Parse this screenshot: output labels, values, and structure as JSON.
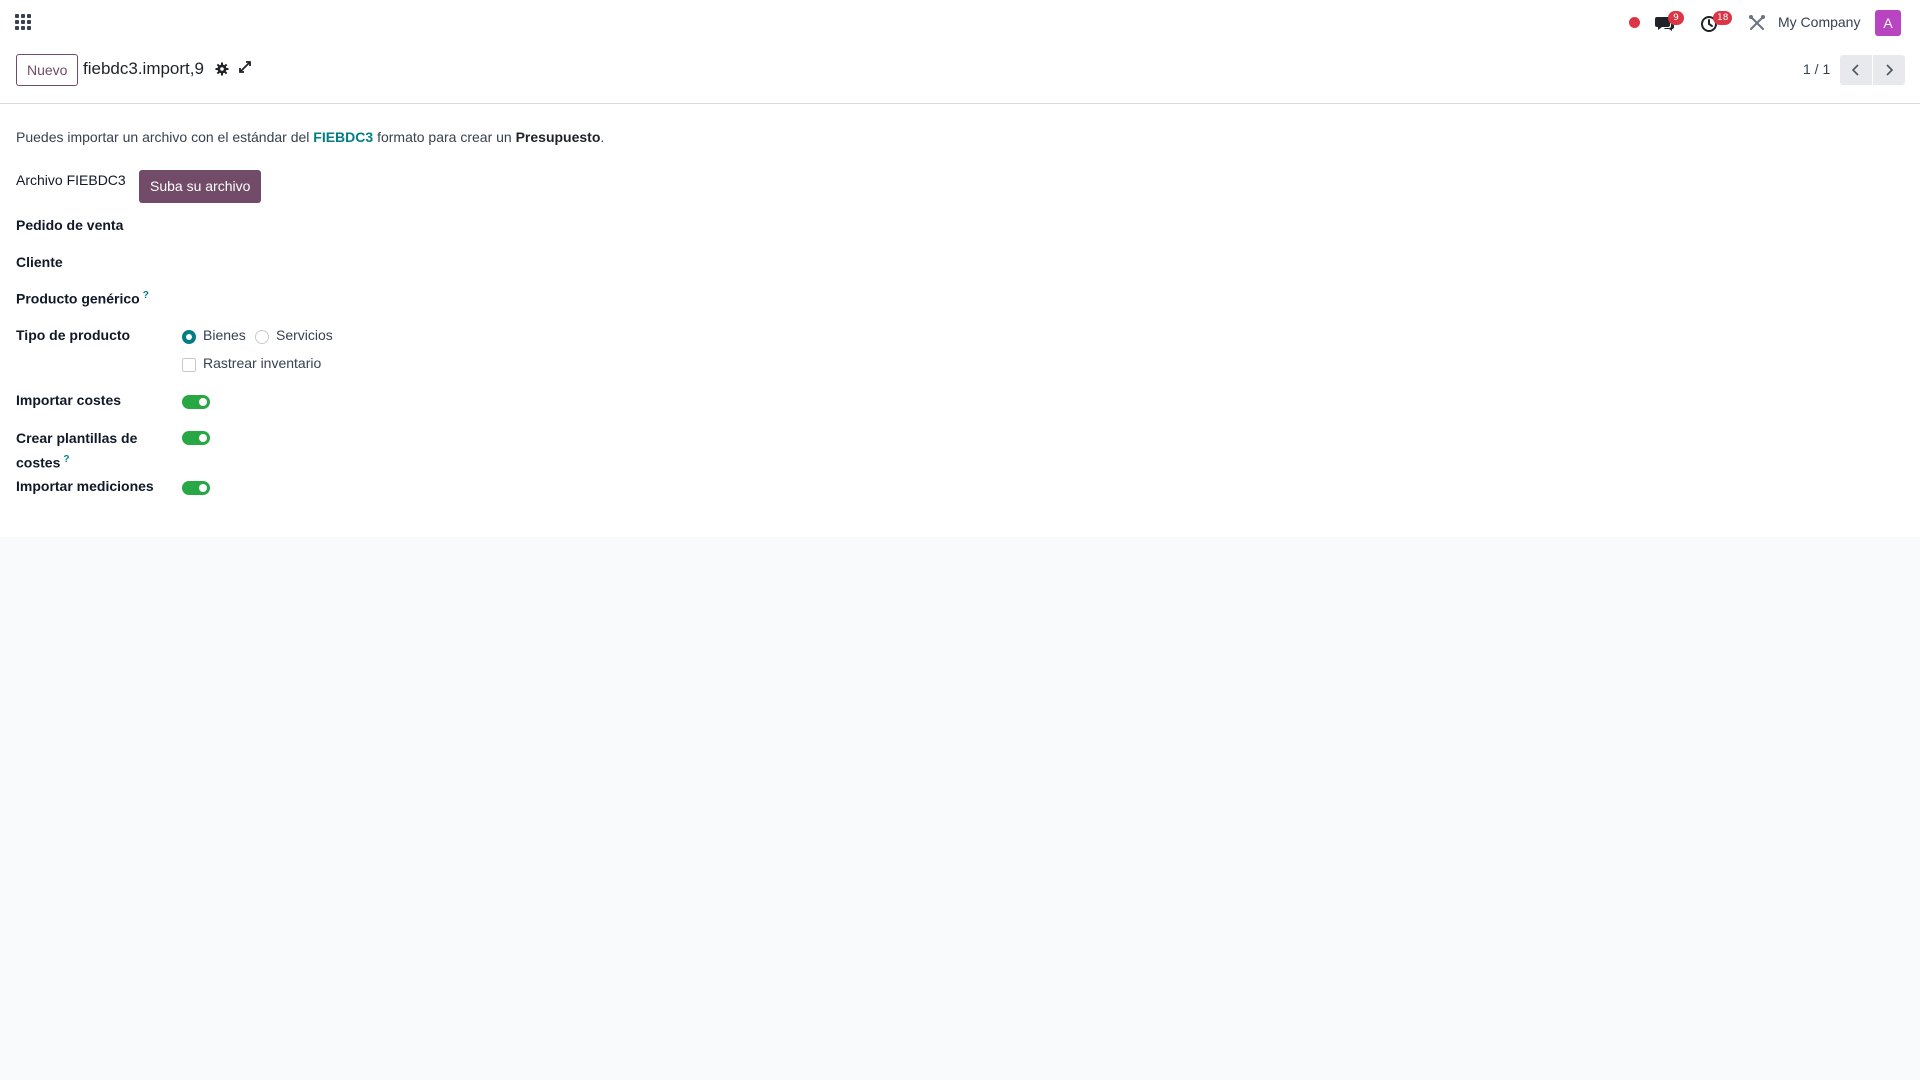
{
  "navbar": {
    "apps_icon": "grid-icon",
    "messages_icon": "chat-icon",
    "messages_count": "9",
    "activities_icon": "clock-icon",
    "activities_count": "18",
    "debug_icon": "tools-icon",
    "company": "My Company",
    "avatar_letter": "A",
    "avatar_color": "#b944c2",
    "recording_color": "#dc3545"
  },
  "control_panel": {
    "new_label": "Nuevo",
    "record_name": "fiebdc3.import,9",
    "pager": "1 / 1"
  },
  "form": {
    "intro": {
      "before": "Puedes importar un archivo con el estándar del ",
      "format": "FIEBDC3",
      "middle": " formato para crear un ",
      "target": "Presupuesto",
      "after": "."
    },
    "file_label": "Archivo FIEBDC3",
    "upload_label": "Suba su archivo",
    "sale_order_label": "Pedido de venta",
    "customer_label": "Cliente",
    "generic_product_label": "Producto genérico",
    "help_mark": "?",
    "product_type_label": "Tipo de producto",
    "product_type_options": [
      "Bienes",
      "Servicios"
    ],
    "product_type_selected": "Bienes",
    "track_inventory_label": "Rastrear inventario",
    "track_inventory": false,
    "import_costs_label": "Importar costes",
    "import_costs": true,
    "cost_templates_label_line1": "Crear plantillas de",
    "cost_templates_label_line2": "costes",
    "cost_templates": true,
    "import_measurements_label": "Importar mediciones",
    "import_measurements": true
  },
  "colors": {
    "primary": "#714b67",
    "accent": "#017e84",
    "toggle_on": "#28a745",
    "badge": "#dc3545"
  }
}
